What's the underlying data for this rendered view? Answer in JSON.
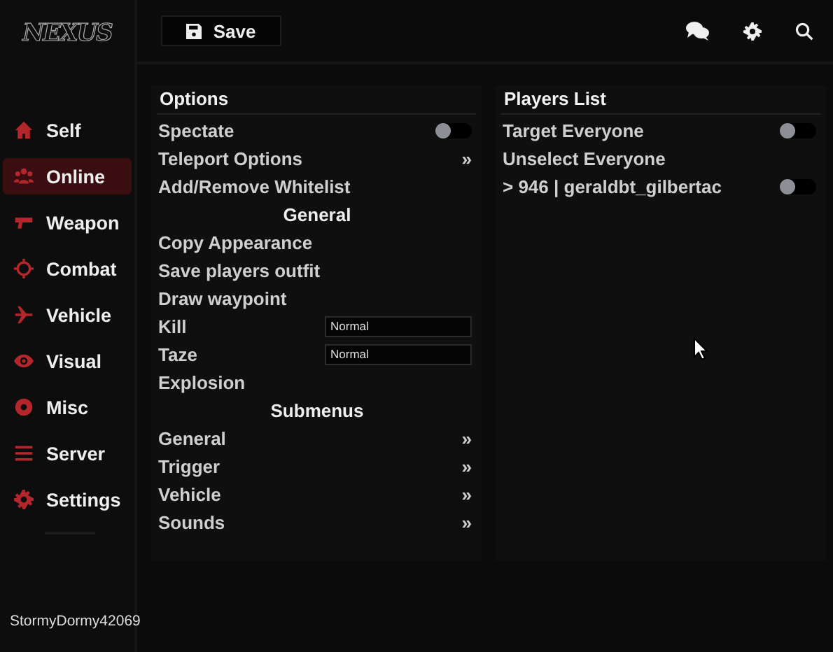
{
  "logo": "NEXUS",
  "toolbar": {
    "save_label": "Save"
  },
  "sidebar": {
    "items": [
      {
        "label": "Self",
        "kind": "home",
        "selected": false
      },
      {
        "label": "Online",
        "kind": "users",
        "selected": true
      },
      {
        "label": "Weapon",
        "kind": "gun",
        "selected": false
      },
      {
        "label": "Combat",
        "kind": "crosshair",
        "selected": false
      },
      {
        "label": "Vehicle",
        "kind": "plane",
        "selected": false
      },
      {
        "label": "Visual",
        "kind": "eye",
        "selected": false
      },
      {
        "label": "Misc",
        "kind": "circle",
        "selected": false
      },
      {
        "label": "Server",
        "kind": "bars",
        "selected": false
      },
      {
        "label": "Settings",
        "kind": "gear",
        "selected": false
      }
    ],
    "username": "StormyDormy42069"
  },
  "options": {
    "title": "Options",
    "rows": [
      {
        "kind": "toggle",
        "label": "Spectate",
        "on": false
      },
      {
        "kind": "submenu",
        "label": "Teleport Options",
        "arrow": "»"
      },
      {
        "kind": "action",
        "label": "Add/Remove Whitelist"
      },
      {
        "kind": "header",
        "label": "General"
      },
      {
        "kind": "action",
        "label": "Copy Appearance"
      },
      {
        "kind": "action",
        "label": "Save players outfit"
      },
      {
        "kind": "action",
        "label": "Draw waypoint"
      },
      {
        "kind": "input",
        "label": "Kill",
        "value": "Normal"
      },
      {
        "kind": "input",
        "label": "Taze",
        "value": "Normal"
      },
      {
        "kind": "action",
        "label": "Explosion"
      },
      {
        "kind": "header",
        "label": "Submenus"
      },
      {
        "kind": "submenu",
        "label": "General",
        "arrow": "»"
      },
      {
        "kind": "submenu",
        "label": "Trigger",
        "arrow": "»"
      },
      {
        "kind": "submenu",
        "label": "Vehicle",
        "arrow": "»"
      },
      {
        "kind": "submenu",
        "label": "Sounds",
        "arrow": "»"
      }
    ]
  },
  "players": {
    "title": "Players List",
    "rows": [
      {
        "kind": "toggle",
        "label": "Target Everyone",
        "on": false
      },
      {
        "kind": "action",
        "label": "Unselect Everyone"
      },
      {
        "kind": "toggle",
        "label": "> 946 | geraldbt_gilbertac",
        "on": false
      }
    ]
  }
}
